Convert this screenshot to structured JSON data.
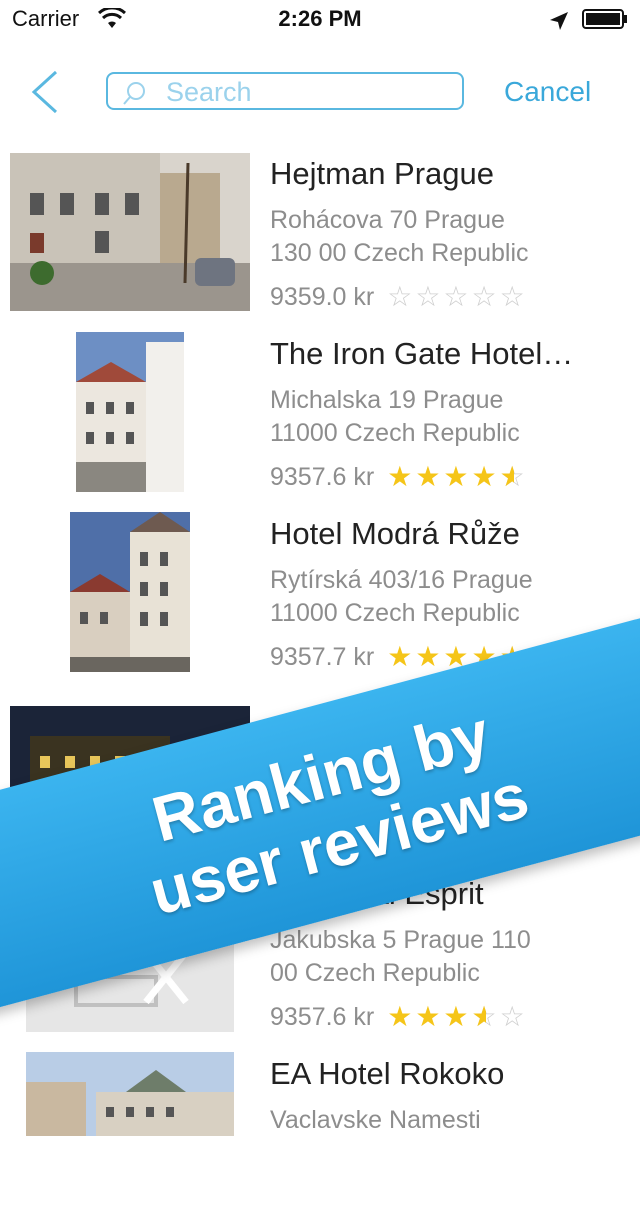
{
  "status_bar": {
    "carrier": "Carrier",
    "time": "2:26 PM"
  },
  "nav": {
    "search_placeholder": "Search",
    "cancel_label": "Cancel"
  },
  "hotels": [
    {
      "name": "Hejtman Prague",
      "address_line1": "Rohácova 70 Prague",
      "address_line2": "130 00 Czech Republic",
      "price": "9359.0 kr",
      "rating": 0
    },
    {
      "name": "The Iron Gate Hotel…",
      "address_line1": "Michalska 19 Prague",
      "address_line2": "11000 Czech Republic",
      "price": "9357.6 kr",
      "rating": 4.5
    },
    {
      "name": "Hotel Modrá Růže",
      "address_line1": "Rytírská 403/16 Prague",
      "address_line2": "11000 Czech Republic",
      "price": "9357.7 kr",
      "rating": 4.5
    },
    {
      "name": "…",
      "address_line1": "",
      "address_line2": "",
      "price": "",
      "rating": 0
    },
    {
      "name": "…l Royal Esprit",
      "address_line1": "Jakubska 5 Prague  110",
      "address_line2": "00 Czech Republic",
      "price": "9357.6 kr",
      "rating": 3.5
    },
    {
      "name": "EA Hotel Rokoko",
      "address_line1": "Vaclavske Namesti",
      "address_line2": "",
      "price": "",
      "rating": 0
    }
  ],
  "banner": {
    "line1": "Ranking by",
    "line2": "user reviews"
  },
  "colors": {
    "accent": "#3aa8da",
    "star": "#f5c518",
    "banner": "#2aa6e6"
  }
}
